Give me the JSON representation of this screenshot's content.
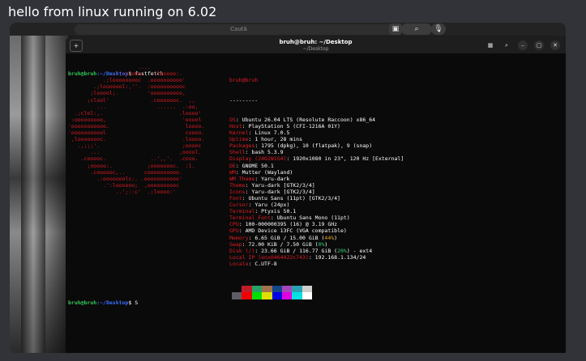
{
  "message": "hello from linux running on 6.02",
  "browser": {
    "search_placeholder": "Caută",
    "buttons": [
      "▣",
      "⌕",
      "🎙"
    ]
  },
  "terminal": {
    "title": "bruh@bruh: ~/Desktop",
    "subtitle": "~/Desktop",
    "new_tab_icon": "+",
    "window_buttons": [
      "▦",
      "⌕",
      "–",
      "▢",
      "✕"
    ],
    "prompt": {
      "user": "bruh@bruh",
      "path": ":~/Desktop",
      "symbol": "$ "
    },
    "command": "fastfetch",
    "final_command": "S",
    "logo_lines": [
      "                      ....",
      "              .',:clooo:  .:looooo:.",
      "           .;looooooooc  .oooooooooo'",
      "        .;looooool:,''.  :ooooooooooc",
      "       ;looool;.         'oooooooooo,",
      "      ;clool'             .cooooooc.  ,,",
      "         ...                ......  .:oo,",
      "  .;clol:,.                        .loooo'",
      " :ooooooooo,                        'ooool",
      "'ooooooooooo.                        loooo.",
      "'ooooooooool                         coooo.",
      " ,loooooooc.                        .loooo.",
      "   .,;;;'.                          ;ooooc",
      "       ...                         ,ooool.",
      "    .cooooc.              ..',,'.  .cooo.",
      "      ;ooooo:.           ;oooooooc.  :l.",
      "       .coooooc,..      coooooooooo.",
      "         .:ooooooolc:. .ooooooooooo'",
      "           .':loooooo;  ,oooooooooc",
      "               ..';::c'  .;loooo:'"
    ],
    "info_header": "bruh@bruh",
    "separator": "---------",
    "info": [
      {
        "key": "OS",
        "value": "Ubuntu 26.04 LTS (Resolute Raccoon) x86_64"
      },
      {
        "key": "Host",
        "value": "PlayStation 5 (CFI-1216A 01Y)"
      },
      {
        "key": "Kernel",
        "value": "Linux 7.0.5"
      },
      {
        "key": "Uptime",
        "value": "1 hour, 28 mins"
      },
      {
        "key": "Packages",
        "value": "1795 (dpkg), 10 (flatpak), 9 (snap)"
      },
      {
        "key": "Shell",
        "value": "bash 5.3.9"
      },
      {
        "key": "Display (24G2W1G4)",
        "value": "1920x1080 in 23\", 120 Hz [External]"
      },
      {
        "key": "DE",
        "value": "GNOME 50.1"
      },
      {
        "key": "WM",
        "value": "Mutter (Wayland)"
      },
      {
        "key": "WM Theme",
        "value": "Yaru-dark"
      },
      {
        "key": "Theme",
        "value": "Yaru-dark [GTK2/3/4]"
      },
      {
        "key": "Icons",
        "value": "Yaru-dark [GTK2/3/4]"
      },
      {
        "key": "Font",
        "value": "Ubuntu Sans (11pt) [GTK2/3/4]"
      },
      {
        "key": "Cursor",
        "value": "Yaru (24px)"
      },
      {
        "key": "Terminal",
        "value": "Ptyxis 50.1"
      },
      {
        "key": "Terminal Font",
        "value": "Ubuntu Sans Mono (11pt)"
      },
      {
        "key": "CPU",
        "value": "100-000000395 (16) @ 3.19 GHz"
      },
      {
        "key": "GPU",
        "value": "AMD Device 13FC (VGA compatible)"
      },
      {
        "key": "Memory",
        "value": "6.65 GiB / 15.00 GiB",
        "percent": "44%",
        "percent_color": "#e5a50a"
      },
      {
        "key": "Swap",
        "value": "72.00 KiB / 7.50 GiB",
        "percent": "0%",
        "percent_color": "#33d17a"
      },
      {
        "key": "Disk (/)",
        "value": "23.66 GiB / 116.77 GiB",
        "percent": "20%",
        "percent_color": "#33d17a",
        "suffix": " - ext4"
      },
      {
        "key": "Local IP (enx0464422c743)",
        "value": "192.168.1.134/24"
      },
      {
        "key": "Locale",
        "value": "C.UTF-8"
      }
    ],
    "palette_top": [
      "#0a0a0a",
      "#c01c28",
      "#26a269",
      "#a2734c",
      "#12488b",
      "#a347ba",
      "#2aa1b3",
      "#d0cfcc"
    ],
    "palette_bottom": [
      "#5e5c64",
      "#f00000",
      "#00e000",
      "#e0e000",
      "#0000e0",
      "#e000e0",
      "#00e0e0",
      "#ffffff"
    ]
  }
}
